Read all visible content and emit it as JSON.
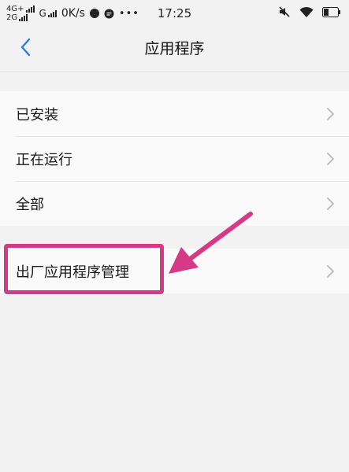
{
  "status_bar": {
    "net1": "4G+",
    "net2": "2G",
    "net3": "G",
    "speed": "0K/s",
    "time": "17:25"
  },
  "header": {
    "title": "应用程序"
  },
  "list": {
    "items": [
      {
        "label": "已安装"
      },
      {
        "label": "正在运行"
      },
      {
        "label": "全部"
      }
    ],
    "factory": {
      "label": "出厂应用程序管理"
    }
  },
  "colors": {
    "accent": "#2b7be5",
    "annotation": "#d63a86",
    "background": "#f2f2f2"
  }
}
